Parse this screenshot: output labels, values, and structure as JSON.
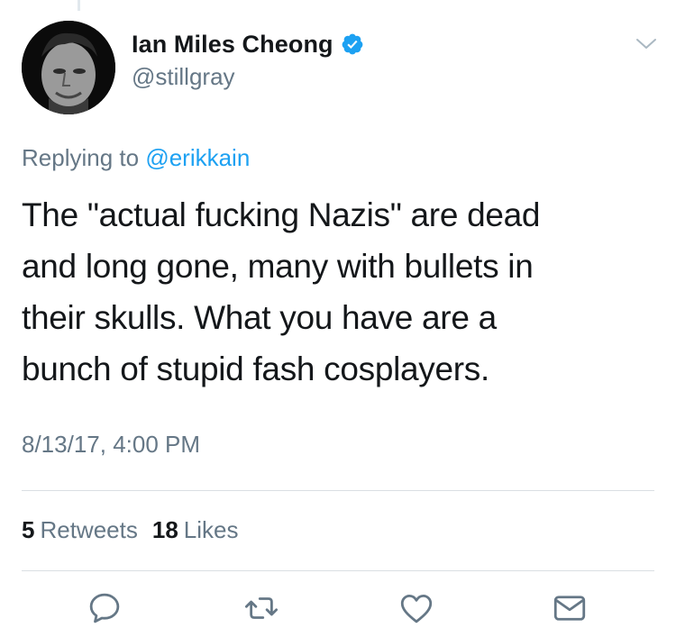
{
  "author": {
    "display_name": "Ian Miles Cheong",
    "handle": "@stillgray",
    "verified": true
  },
  "reply": {
    "prefix": "Replying to",
    "to": "@erikkain"
  },
  "tweet": {
    "lines": [
      "The \"actual fucking Nazis\" are dead",
      "and long gone, many with bullets in",
      "their skulls. What you have are a",
      "bunch of stupid fash cosplayers."
    ],
    "timestamp": "8/13/17, 4:00 PM"
  },
  "stats": {
    "retweets_count": "5",
    "retweets_label": "Retweets",
    "likes_count": "18",
    "likes_label": "Likes"
  },
  "actions": [
    "reply-icon",
    "retweet-icon",
    "heart-icon",
    "envelope-icon"
  ],
  "colors": {
    "accent": "#1da1f2",
    "secondary_text": "#657786",
    "primary_text": "#14171a",
    "divider": "#dadfe3"
  }
}
